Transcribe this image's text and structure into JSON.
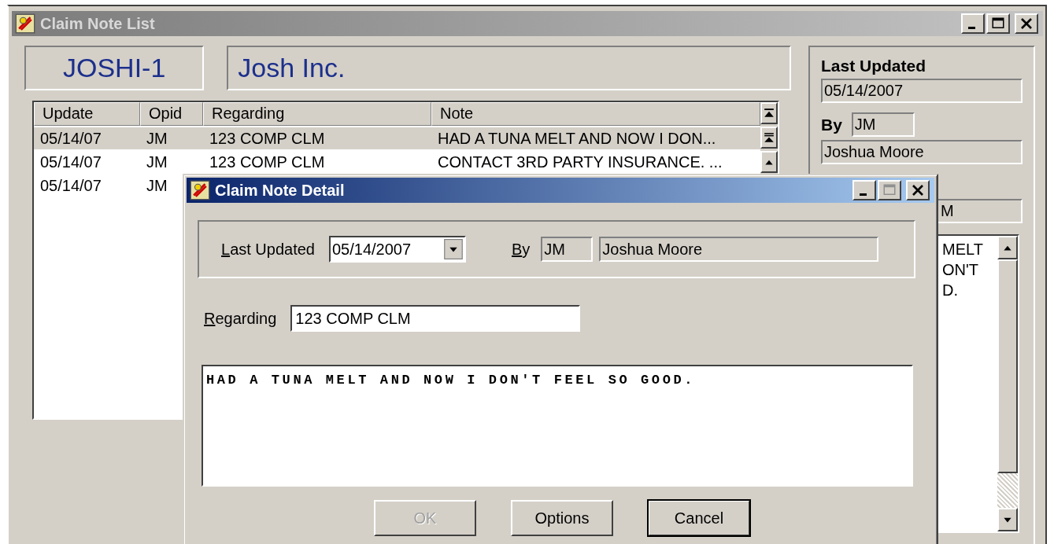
{
  "main_window": {
    "title": "Claim Note List",
    "active": false
  },
  "header": {
    "code": "JOSHI-1",
    "name": "Josh Inc."
  },
  "note_list": {
    "columns": [
      "Update",
      "Opid",
      "Regarding",
      "Note"
    ],
    "rows": [
      {
        "cells": [
          "05/14/07",
          "JM",
          "123 COMP CLM",
          "HAD A TUNA MELT AND NOW I DON..."
        ],
        "selected": true
      },
      {
        "cells": [
          "05/14/07",
          "JM",
          "123 COMP CLM",
          "CONTACT 3RD PARTY INSURANCE. ..."
        ],
        "selected": false
      },
      {
        "cells": [
          "05/14/07",
          "JM"
        ],
        "selected": false
      }
    ]
  },
  "summary_panel": {
    "last_updated_label": "Last Updated",
    "last_updated": "05/14/2007",
    "by_label": "By",
    "by_code": "JM",
    "by_name": "Joshua Moore",
    "field_4": "M",
    "note_lines": [
      "MELT",
      "ON'T",
      "D."
    ]
  },
  "dialog": {
    "title": "Claim Note Detail",
    "active": true,
    "last_updated_label": "Last Updated",
    "last_updated": "05/14/2007",
    "by_label": "By",
    "by_code": "JM",
    "by_name": "Joshua Moore",
    "regarding_label": "Regarding",
    "regarding": "123 COMP CLM",
    "note": "HAD A TUNA MELT AND NOW I DON'T FEEL SO GOOD.",
    "buttons": [
      {
        "label": "OK",
        "disabled": true,
        "default": false
      },
      {
        "label": "Options",
        "disabled": false,
        "default": false
      },
      {
        "label": "Cancel",
        "disabled": false,
        "default": true
      }
    ]
  }
}
